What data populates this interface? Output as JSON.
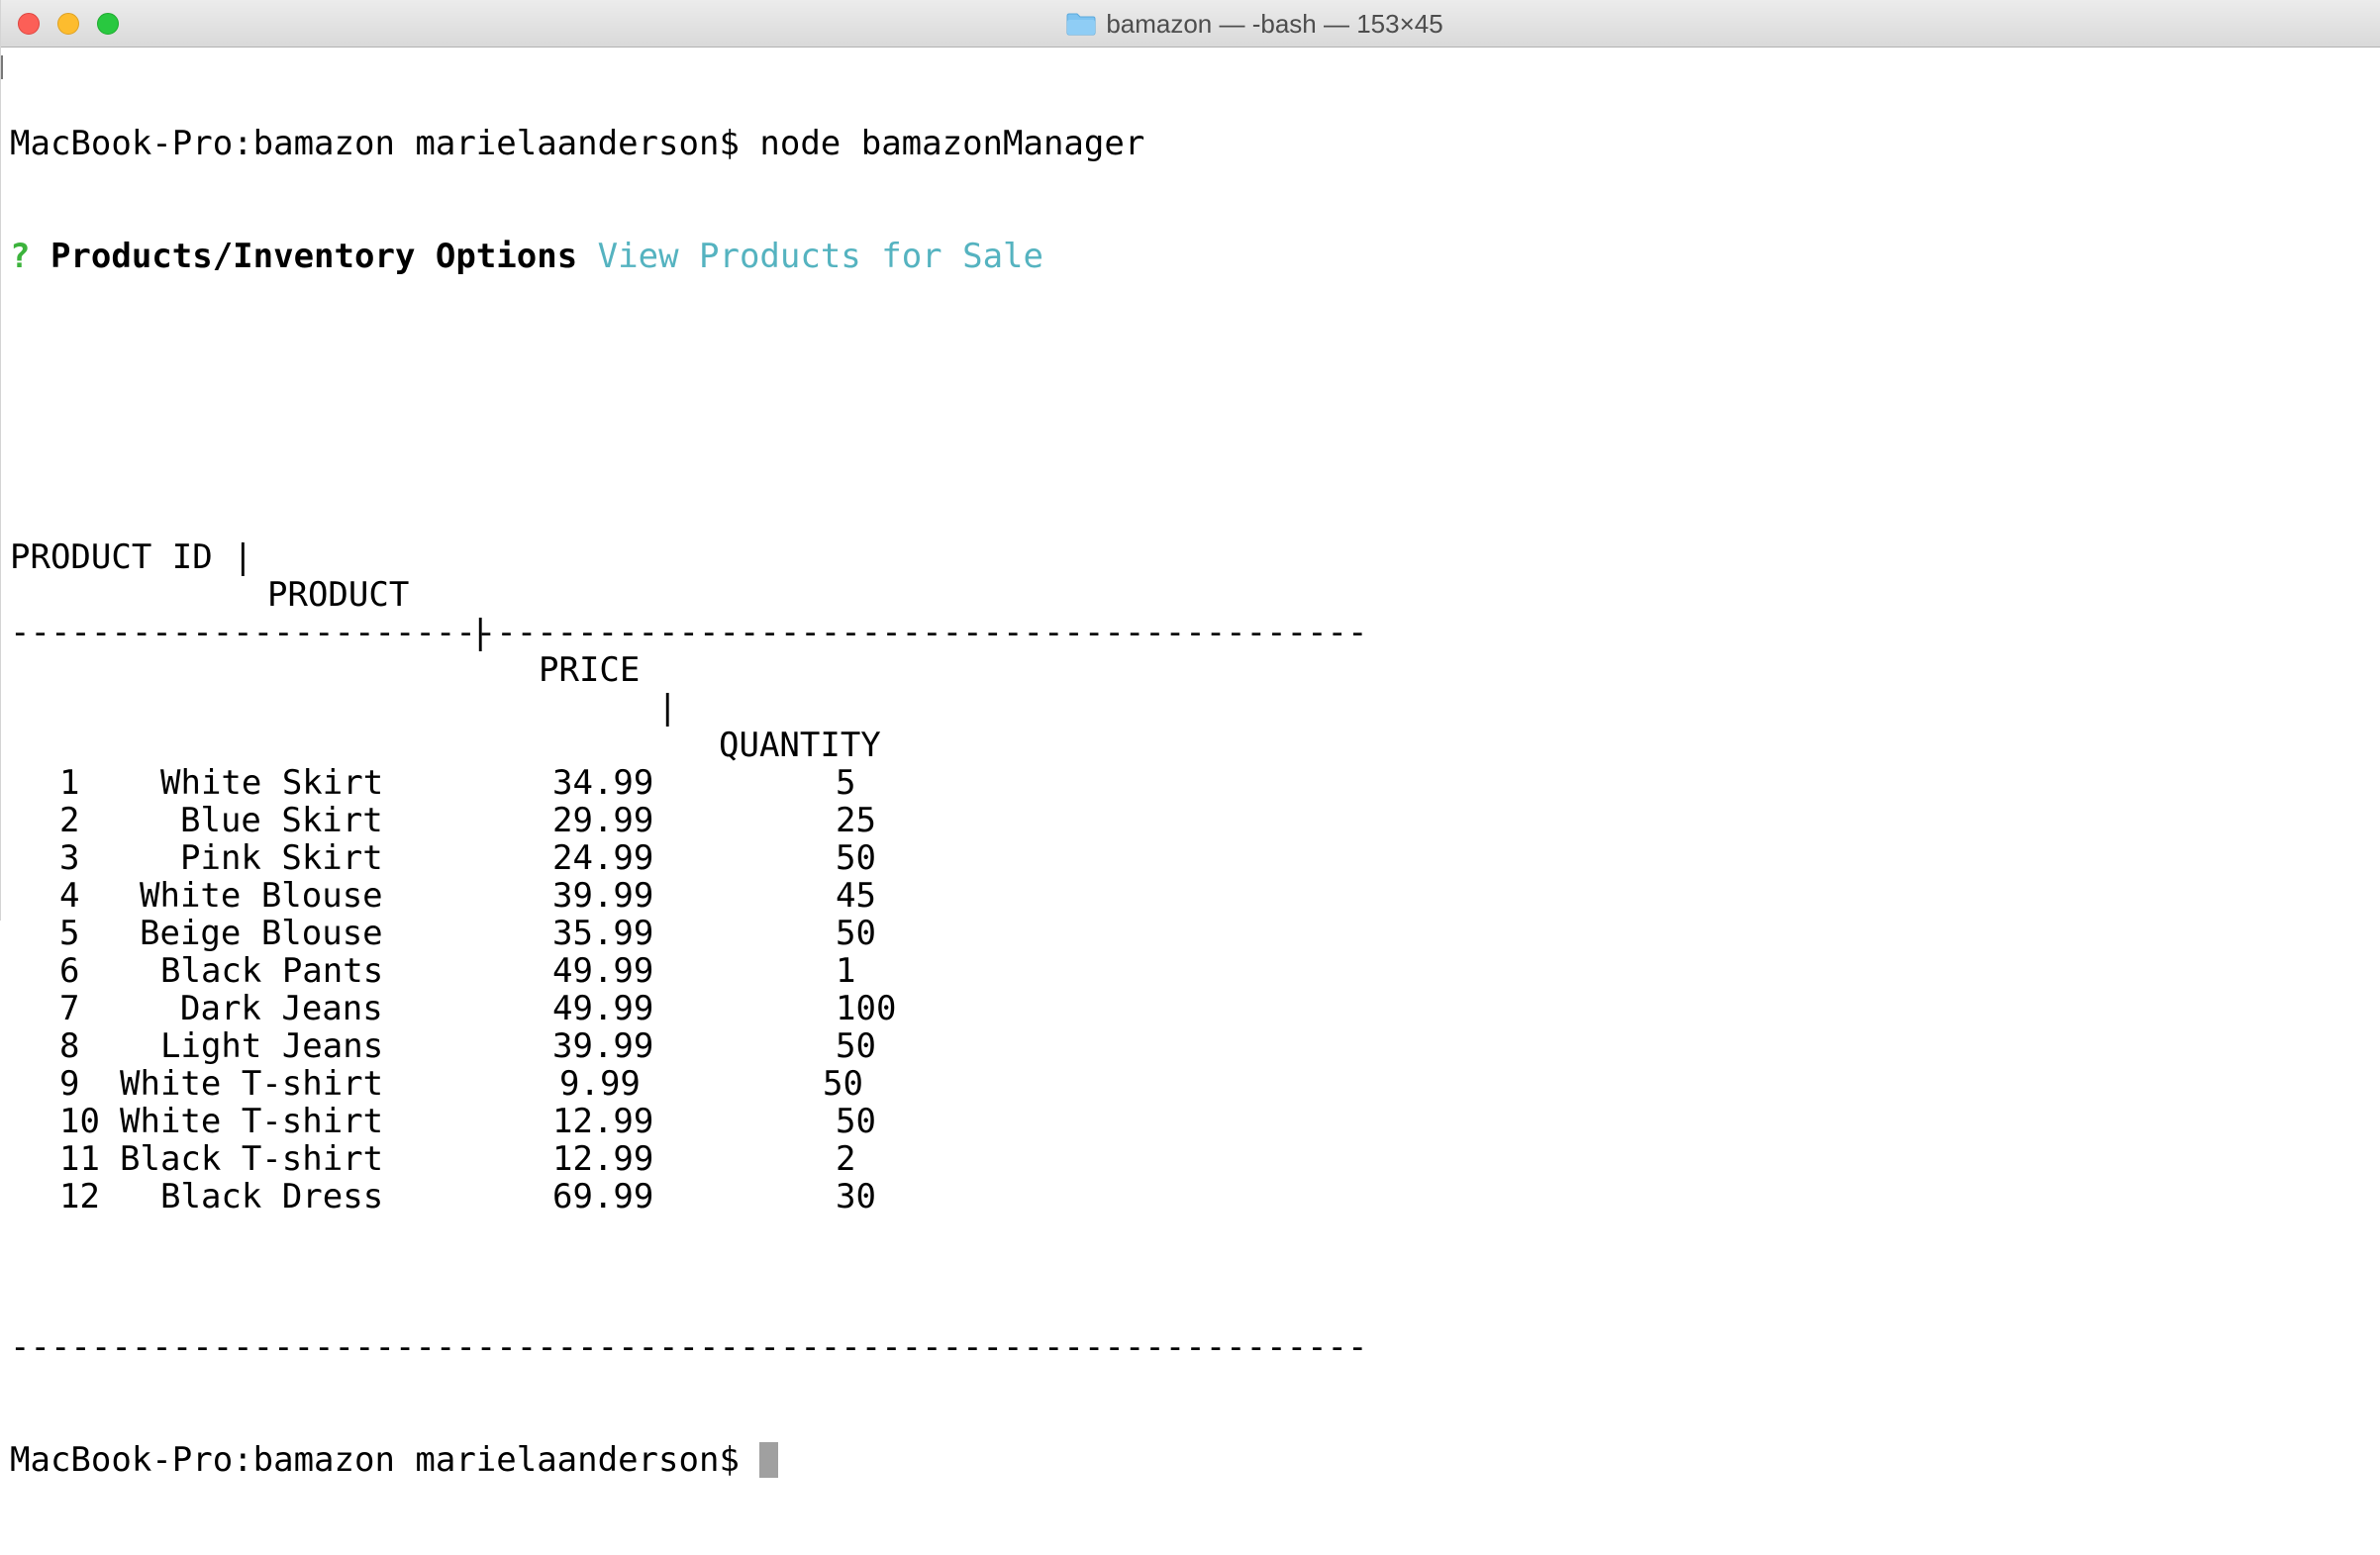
{
  "window": {
    "title": "bamazon — -bash — 153×45",
    "folder_icon": "folder-icon",
    "colors": {
      "close": "#fc5f57",
      "minimize": "#fdbc2e",
      "zoom": "#29c840"
    }
  },
  "terminal": {
    "command_prompt": "MacBook-Pro:bamazon marielaanderson$ ",
    "command": "node bamazonManager",
    "question_mark": "? ",
    "question": "Products/Inventory Options",
    "answer": "View Products for Sale",
    "table_header": {
      "id": "PRODUCT ID |",
      "product": "PRODUCT",
      "sep1": "|",
      "price": "PRICE",
      "sep2": "|",
      "quantity": "QUANTITY"
    },
    "divider": "-------------------------------------------------------------------",
    "rows": [
      {
        "id": "1",
        "product": "White Skirt",
        "price": "34.99",
        "quantity": "5"
      },
      {
        "id": "2",
        "product": "Blue Skirt",
        "price": "29.99",
        "quantity": "25"
      },
      {
        "id": "3",
        "product": "Pink Skirt",
        "price": "24.99",
        "quantity": "50"
      },
      {
        "id": "4",
        "product": "White Blouse",
        "price": "39.99",
        "quantity": "45"
      },
      {
        "id": "5",
        "product": "Beige Blouse",
        "price": "35.99",
        "quantity": "50"
      },
      {
        "id": "6",
        "product": "Black Pants",
        "price": "49.99",
        "quantity": "1"
      },
      {
        "id": "7",
        "product": "Dark Jeans",
        "price": "49.99",
        "quantity": "100"
      },
      {
        "id": "8",
        "product": "Light Jeans",
        "price": "39.99",
        "quantity": "50"
      },
      {
        "id": "9",
        "product": "White T-shirt",
        "price": "9.99",
        "quantity": "50"
      },
      {
        "id": "10",
        "product": "White T-shirt",
        "price": "12.99",
        "quantity": "50"
      },
      {
        "id": "11",
        "product": "Black T-shirt",
        "price": "12.99",
        "quantity": "2"
      },
      {
        "id": "12",
        "product": "Black Dress",
        "price": "69.99",
        "quantity": "30"
      }
    ],
    "final_prompt": "MacBook-Pro:bamazon marielaanderson$ "
  }
}
